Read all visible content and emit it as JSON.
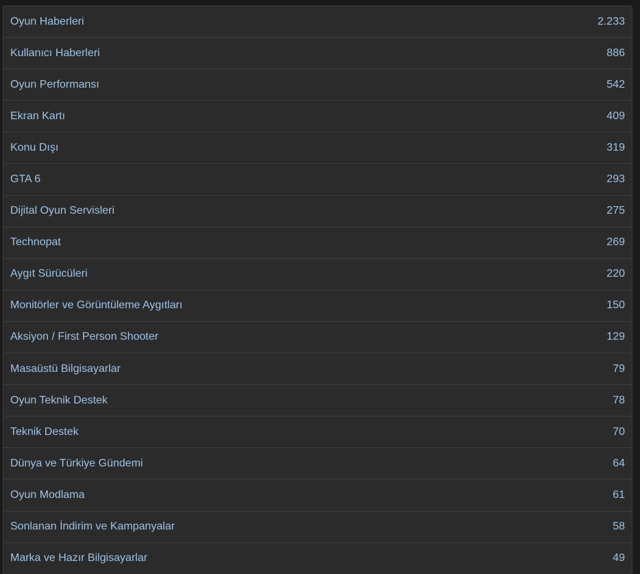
{
  "forum_stats": {
    "rows": [
      {
        "label": "Oyun Haberleri",
        "count": "2.233"
      },
      {
        "label": "Kullanıcı Haberleri",
        "count": "886"
      },
      {
        "label": "Oyun Performansı",
        "count": "542"
      },
      {
        "label": "Ekran Kartı",
        "count": "409"
      },
      {
        "label": "Konu Dışı",
        "count": "319"
      },
      {
        "label": "GTA 6",
        "count": "293"
      },
      {
        "label": "Dijital Oyun Servisleri",
        "count": "275"
      },
      {
        "label": "Technopat",
        "count": "269"
      },
      {
        "label": "Aygıt Sürücüleri",
        "count": "220"
      },
      {
        "label": "Monitörler ve Görüntüleme Aygıtları",
        "count": "150"
      },
      {
        "label": "Aksiyon / First Person Shooter",
        "count": "129"
      },
      {
        "label": "Masaüstü Bilgisayarlar",
        "count": "79"
      },
      {
        "label": "Oyun Teknik Destek",
        "count": "78"
      },
      {
        "label": "Teknik Destek",
        "count": "70"
      },
      {
        "label": "Dünya ve Türkiye Gündemi",
        "count": "64"
      },
      {
        "label": "Oyun Modlama",
        "count": "61"
      },
      {
        "label": "Sonlanan İndirim ve Kampanyalar",
        "count": "58"
      },
      {
        "label": "Marka ve Hazır Bilgisayarlar",
        "count": "49"
      }
    ]
  }
}
